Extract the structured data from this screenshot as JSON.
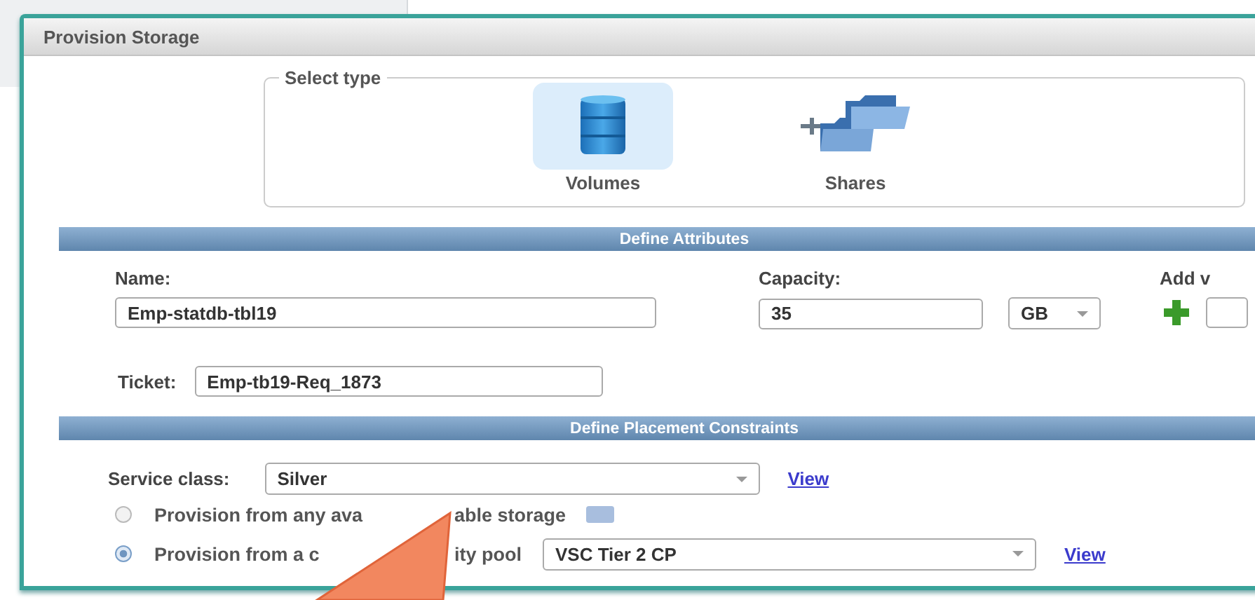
{
  "window": {
    "title": "Provision Storage"
  },
  "select_type": {
    "legend": "Select type",
    "options": [
      {
        "label": "Volumes",
        "kind": "volumes",
        "selected": true
      },
      {
        "label": "Shares",
        "kind": "shares",
        "selected": false
      }
    ]
  },
  "attributes": {
    "header": "Define Attributes",
    "name": {
      "label": "Name:",
      "value": "Emp-statdb-tbl19"
    },
    "capacity": {
      "label": "Capacity:",
      "value": "35",
      "unit": "GB"
    },
    "add": {
      "label": "Add v"
    },
    "ticket": {
      "label": "Ticket:",
      "value": "Emp-tb19-Req_1873"
    }
  },
  "placement": {
    "header": "Define Placement Constraints",
    "service_class": {
      "label": "Service class:",
      "value": "Silver",
      "link": "View"
    },
    "options": [
      {
        "kind": "help",
        "parts": [
          "Provision from any ava",
          "able storage"
        ],
        "selected": false
      },
      {
        "kind": "pool",
        "parts": [
          "Provision from a c",
          "ity pool"
        ],
        "selected": true,
        "value": "VSC Tier 2 CP",
        "link": "View"
      }
    ]
  }
}
